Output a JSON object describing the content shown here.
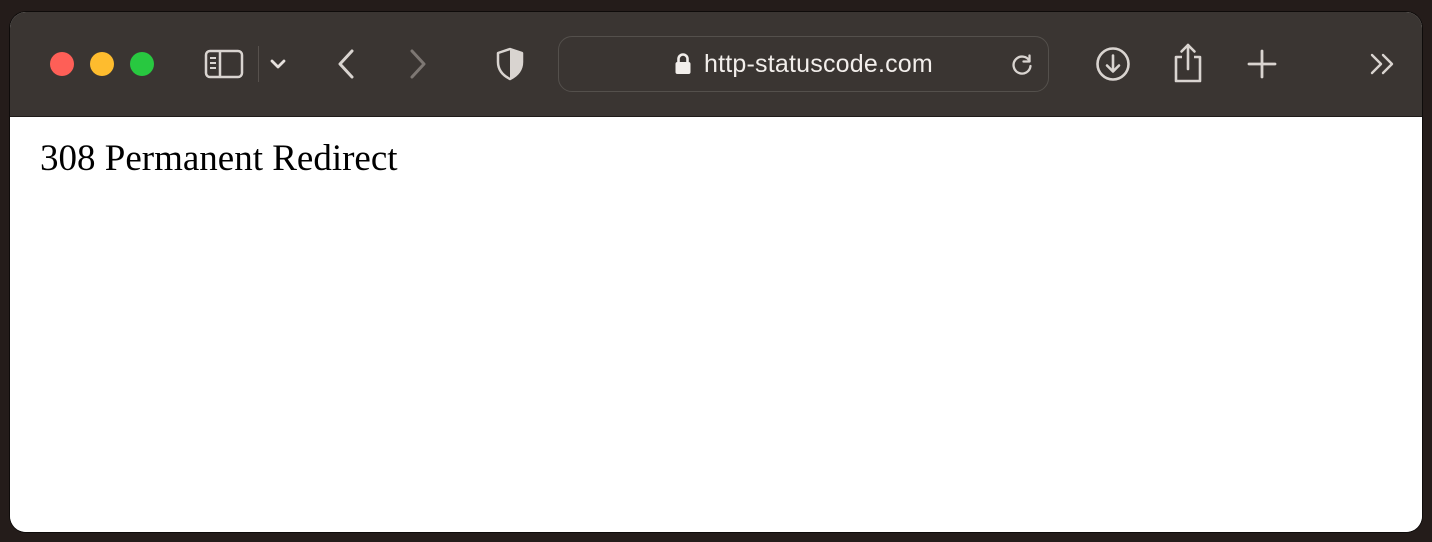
{
  "window": {
    "controls": [
      "close",
      "minimize",
      "zoom"
    ]
  },
  "toolbar": {
    "icons": {
      "sidebar": "sidebar-icon",
      "sidebar_menu": "chevron-down-icon",
      "back": "chevron-left-icon",
      "forward": "chevron-right-icon",
      "privacy": "shield-icon",
      "lock": "lock-icon",
      "reload": "reload-icon",
      "download": "download-icon",
      "share": "share-icon",
      "new_tab": "plus-icon",
      "overflow": "double-chevron-right-icon"
    },
    "forward_enabled": false
  },
  "address_bar": {
    "url": "http-statuscode.com"
  },
  "page": {
    "heading": "308 Permanent Redirect"
  },
  "colors": {
    "toolbar_bg": "#3a3532",
    "close": "#fe5f57",
    "minimize": "#febc2e",
    "zoom": "#28c840",
    "icon": "#d9d4d0",
    "icon_disabled": "#7d7773"
  }
}
